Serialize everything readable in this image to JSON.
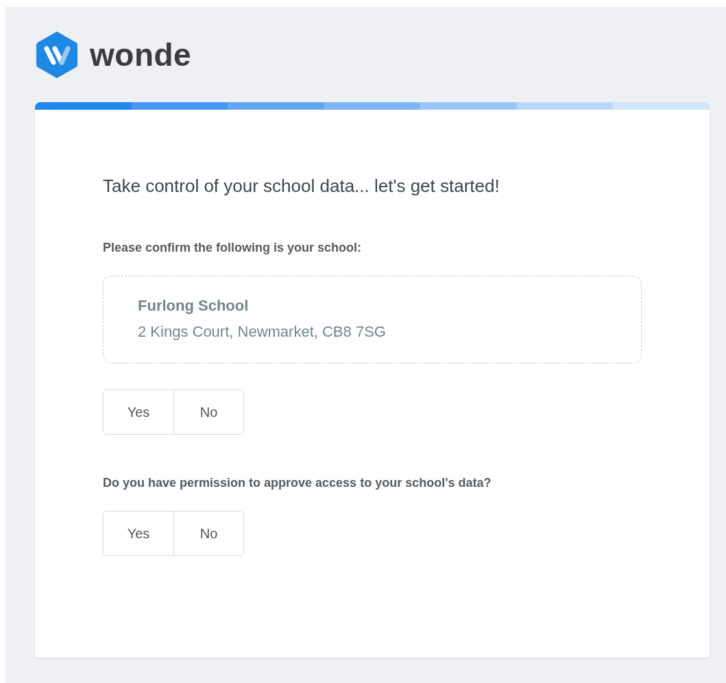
{
  "brand": {
    "name": "wonde"
  },
  "heading": "Take control of your school data... let's get started!",
  "questions": [
    {
      "label": "Please confirm the following is your school:",
      "school": {
        "name": "Furlong School",
        "address": "2 Kings Court, Newmarket, CB8 7SG"
      },
      "options": [
        {
          "label": "Yes",
          "selected": false
        },
        {
          "label": "No",
          "selected": false
        }
      ]
    },
    {
      "label": "Do you have permission to approve access to your school's data?",
      "options": [
        {
          "label": "Yes",
          "selected": false
        },
        {
          "label": "No",
          "selected": false
        }
      ]
    }
  ]
}
